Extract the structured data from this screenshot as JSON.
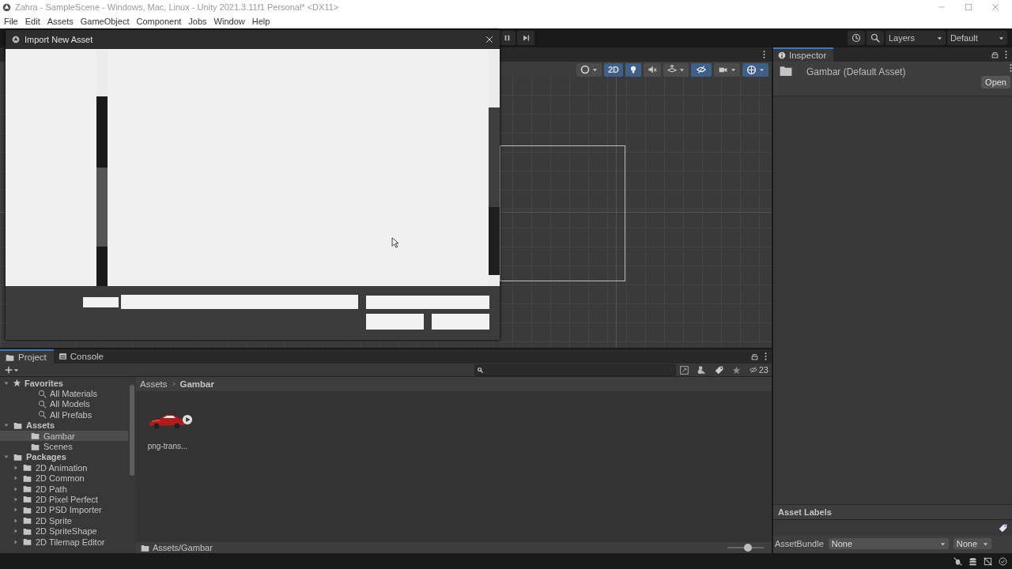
{
  "window": {
    "title": "Zahra - SampleScene - Windows, Mac, Linux - Unity 2021.3.11f1 Personal* <DX11>"
  },
  "menu": [
    "File",
    "Edit",
    "Assets",
    "GameObject",
    "Component",
    "Jobs",
    "Window",
    "Help"
  ],
  "toolbar": {
    "layers": "Layers",
    "layout": "Default"
  },
  "import_dialog": {
    "title": "Import New Asset"
  },
  "scene_toolbar": [
    {
      "kind": "shading",
      "selected": false
    },
    {
      "kind": "text",
      "label": "2D",
      "selected": true
    },
    {
      "kind": "light",
      "selected": true
    },
    {
      "kind": "audio",
      "selected": false
    },
    {
      "kind": "effects",
      "selected": false
    },
    {
      "kind": "visibility",
      "selected": true
    },
    {
      "kind": "camera",
      "selected": false
    },
    {
      "kind": "gizmos",
      "selected": true
    }
  ],
  "inspector": {
    "tab": "Inspector",
    "asset_title": "Gambar (Default Asset)",
    "open_button": "Open",
    "labels_header": "Asset Labels",
    "asset_bundle": {
      "label": "AssetBundle",
      "name": "None",
      "variant": "None"
    }
  },
  "project": {
    "tabs": [
      {
        "label": "Project",
        "selected": true
      },
      {
        "label": "Console",
        "selected": false
      }
    ],
    "hidden_count": "23",
    "tree": [
      {
        "label": "Favorites",
        "kind": "favorites",
        "expanded": true,
        "selected": false,
        "children": [
          {
            "label": "All Materials",
            "kind": "search",
            "selected": false
          },
          {
            "label": "All Models",
            "kind": "search",
            "selected": false
          },
          {
            "label": "All Prefabs",
            "kind": "search",
            "selected": false
          }
        ]
      },
      {
        "label": "Assets",
        "kind": "folder",
        "expanded": true,
        "selected": false,
        "children": [
          {
            "label": "Gambar",
            "kind": "folder",
            "selected": true
          },
          {
            "label": "Scenes",
            "kind": "folder",
            "selected": false
          }
        ]
      },
      {
        "label": "Packages",
        "kind": "folder",
        "expanded": true,
        "selected": false,
        "children": [
          {
            "label": "2D Animation",
            "kind": "folder",
            "expanded": false,
            "selected": false
          },
          {
            "label": "2D Common",
            "kind": "folder",
            "expanded": false,
            "selected": false
          },
          {
            "label": "2D Path",
            "kind": "folder",
            "expanded": false,
            "selected": false
          },
          {
            "label": "2D Pixel Perfect",
            "kind": "folder",
            "expanded": false,
            "selected": false
          },
          {
            "label": "2D PSD Importer",
            "kind": "folder",
            "expanded": false,
            "selected": false
          },
          {
            "label": "2D Sprite",
            "kind": "folder",
            "expanded": false,
            "selected": false
          },
          {
            "label": "2D SpriteShape",
            "kind": "folder",
            "expanded": false,
            "selected": false
          },
          {
            "label": "2D Tilemap Editor",
            "kind": "folder",
            "expanded": false,
            "selected": false
          }
        ]
      }
    ],
    "breadcrumb": [
      "Assets",
      "Gambar"
    ],
    "files": [
      {
        "name": "png-trans...",
        "kind": "picture"
      }
    ],
    "path": "Assets/Gambar",
    "zoom": {
      "level": 0.57
    }
  }
}
